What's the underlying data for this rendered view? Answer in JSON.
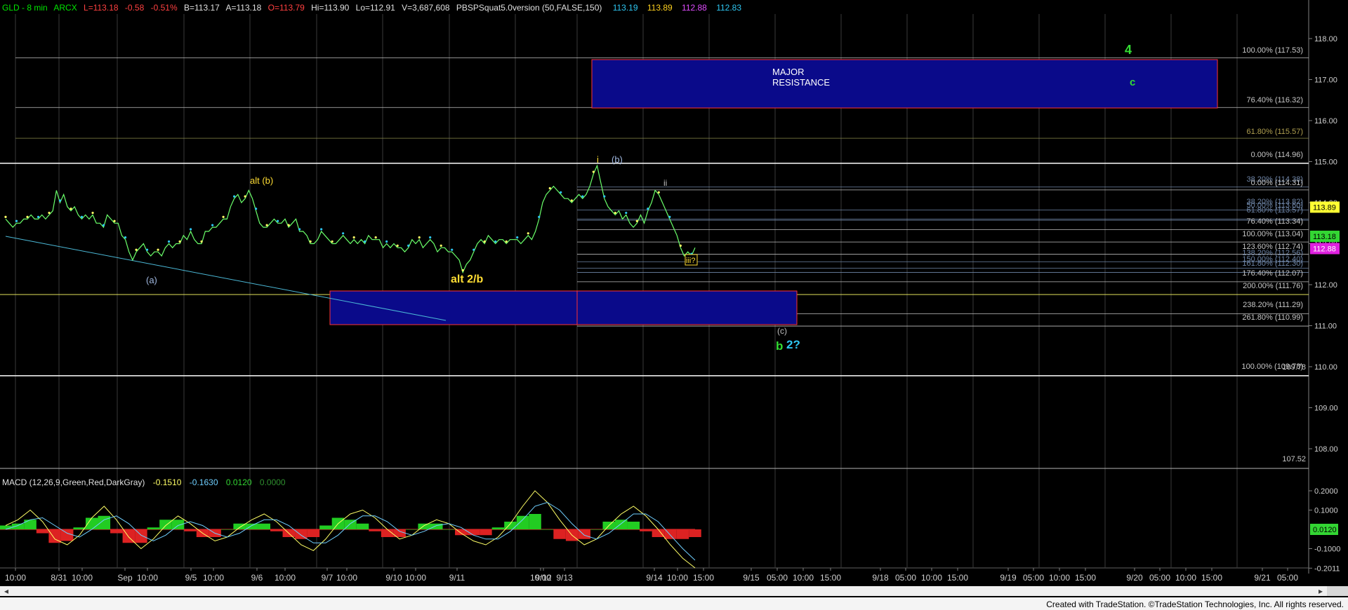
{
  "header": {
    "symbol": "GLD - 8 min",
    "exchange": "ARCX",
    "last": "L=113.18",
    "change": "-0.58",
    "change_pct": "-0.51%",
    "bid": "B=113.17",
    "ask": "A=113.18",
    "open": "O=113.79",
    "high": "Hi=113.90",
    "low": "Lo=112.91",
    "volume": "V=3,687,608",
    "study": "PBSPSquat5.0version (50,FALSE,150)",
    "study_values": [
      {
        "text": "113.19",
        "color": "#2ec7f2"
      },
      {
        "text": "113.89",
        "color": "#ffd21f"
      },
      {
        "text": "112.88",
        "color": "#e04cff"
      },
      {
        "text": "112.83",
        "color": "#2ec7f2"
      }
    ]
  },
  "price_axis": {
    "ticks": [
      "118.00",
      "117.00",
      "116.00",
      "115.00",
      "114.00",
      "113.00",
      "112.00",
      "111.00",
      "110.00",
      "109.00",
      "108.00"
    ],
    "badges": [
      {
        "text": "113.89",
        "color": "#ffff33",
        "text_color": "#000000"
      },
      {
        "text": "113.18",
        "color": "#33d633",
        "text_color": "#000000"
      },
      {
        "text": "112.88",
        "color": "#e020e0",
        "text_color": "#ffffff"
      }
    ]
  },
  "fib_labels": [
    {
      "text": "100.00% (117.53)",
      "color": "#c8c8c8"
    },
    {
      "text": "76.40% (116.32)",
      "color": "#c8c8c8"
    },
    {
      "text": "61.80% (115.57)",
      "color": "#b0a050"
    },
    {
      "text": "0.00% (114.96)",
      "color": "#c8c8c8"
    },
    {
      "text": "38.20% (114.38)",
      "color": "#6f86a8"
    },
    {
      "text": "0.00% (114.31)",
      "color": "#c8c8c8"
    },
    {
      "text": "38.20% (113.82)",
      "color": "#6f86a8"
    },
    {
      "text": "50.00% (113.60)",
      "color": "#6f86a8"
    },
    {
      "text": "61.80% (113.57)",
      "color": "#6f86a8"
    },
    {
      "text": "76.40% (113.34)",
      "color": "#c8c8c8"
    },
    {
      "text": "100.00% (113.04)",
      "color": "#c8c8c8"
    },
    {
      "text": "123.60% (112.74)",
      "color": "#c8c8c8"
    },
    {
      "text": "138.20% (112.56)",
      "color": "#6f86a8"
    },
    {
      "text": "150.00% (112.40)",
      "color": "#6f86a8"
    },
    {
      "text": "161.80% (112.30)",
      "color": "#6f86a8"
    },
    {
      "text": "176.40% (112.07)",
      "color": "#c8c8c8"
    },
    {
      "text": "200.00% (111.76)",
      "color": "#c8c8c8"
    },
    {
      "text": "238.20% (111.29)",
      "color": "#c8c8c8"
    },
    {
      "text": "261.80% (110.99)",
      "color": "#c8c8c8"
    },
    {
      "text": "100.00% (109.78)",
      "color": "#c8c8c8"
    },
    {
      "text": "109.78",
      "color": "#c8c8c8"
    },
    {
      "text": "107.52",
      "color": "#c8c8c8"
    }
  ],
  "annotations": {
    "wave_4": "4",
    "wave_c": "c",
    "major_resistance_1": "MAJOR",
    "major_resistance_2": "RESISTANCE",
    "wave_i": "i",
    "wave_b_paren": "(b)",
    "wave_ii": "ii",
    "wave_alt_b": "alt (b)",
    "wave_a_paren": "(a)",
    "wave_alt_2b": "alt 2/b",
    "wave_iii_q": "iii?",
    "wave_c_paren": "(c)",
    "wave_b": "b",
    "wave_2q": "2?"
  },
  "macd": {
    "title": "MACD (12,26,9,Green,Red,DarkGray)",
    "values": [
      {
        "text": "-0.1510",
        "color": "#ffff66"
      },
      {
        "text": "-0.1630",
        "color": "#6fcfff"
      },
      {
        "text": "0.0120",
        "color": "#33d633"
      },
      {
        "text": "0.0000",
        "color": "#2f8f2f"
      }
    ],
    "ticks": [
      "0.2000",
      "0.1000",
      "-0.1000",
      "-0.2011"
    ],
    "badge": "0.0120"
  },
  "time_axis": {
    "labels": [
      "10:00",
      "8/31",
      "10:00",
      "Sep",
      "10:00",
      "9/5",
      "10:00",
      "9/6",
      "10:00",
      "9/7",
      "10:00",
      "9/10",
      "10:00",
      "9/11",
      "9/12",
      "10:00",
      "9/13",
      "9/14",
      "10:00",
      "15:00",
      "9/15",
      "05:00",
      "10:00",
      "15:00",
      "9/18",
      "05:00",
      "10:00",
      "15:00",
      "9/19",
      "05:00",
      "10:00",
      "15:00",
      "9/20",
      "05:00",
      "10:00",
      "15:00",
      "9/21",
      "05:00"
    ]
  },
  "footer": {
    "credit": "Created with TradeStation. ©TradeStation Technologies, Inc. All rights reserved."
  },
  "chart_data": {
    "type": "line",
    "price_range": [
      107.52,
      118.4
    ],
    "close_series": [
      113.6,
      113.5,
      113.4,
      113.5,
      113.5,
      113.6,
      113.6,
      113.7,
      113.6,
      113.6,
      113.7,
      113.6,
      113.7,
      113.8,
      114.3,
      114.0,
      114.2,
      113.9,
      113.8,
      113.9,
      113.7,
      113.6,
      113.7,
      113.6,
      113.7,
      113.5,
      113.5,
      113.4,
      113.7,
      113.6,
      113.5,
      113.5,
      113.2,
      113.1,
      112.8,
      112.6,
      112.8,
      112.9,
      113.0,
      112.8,
      112.7,
      112.8,
      112.8,
      112.7,
      112.9,
      113.0,
      112.9,
      113.0,
      113.0,
      113.2,
      113.1,
      113.3,
      113.1,
      113.0,
      113.0,
      113.3,
      113.3,
      113.4,
      113.4,
      113.5,
      113.6,
      113.6,
      113.9,
      114.1,
      114.2,
      114.0,
      114.1,
      114.3,
      114.1,
      113.8,
      113.5,
      113.4,
      113.4,
      113.5,
      113.6,
      113.5,
      113.5,
      113.6,
      113.4,
      113.5,
      113.6,
      113.3,
      113.3,
      113.2,
      113.0,
      113.0,
      113.1,
      113.3,
      113.2,
      113.1,
      113.0,
      113.0,
      113.1,
      113.2,
      113.1,
      113.0,
      113.1,
      113.0,
      113.1,
      113.0,
      113.2,
      113.1,
      113.1,
      113.1,
      112.9,
      113.0,
      112.9,
      113.0,
      112.9,
      112.9,
      112.8,
      112.9,
      113.1,
      113.0,
      113.1,
      112.9,
      113.0,
      113.1,
      113.0,
      112.8,
      112.9,
      112.9,
      112.8,
      112.8,
      112.7,
      112.6,
      112.3,
      112.5,
      112.6,
      112.8,
      113.0,
      113.1,
      113.0,
      113.2,
      113.1,
      113.0,
      113.1,
      113.1,
      113.0,
      113.1,
      113.1,
      113.1,
      113.0,
      113.1,
      113.2,
      113.1,
      113.3,
      113.6,
      114.0,
      114.2,
      114.3,
      114.4,
      114.3,
      114.2,
      114.1,
      114.1,
      114.0,
      114.1,
      114.2,
      114.1,
      114.2,
      114.4,
      114.7,
      114.9,
      114.5,
      114.1,
      113.9,
      113.8,
      113.7,
      113.8,
      113.6,
      113.7,
      113.5,
      113.4,
      113.5,
      113.7,
      113.5,
      113.8,
      114.0,
      114.3,
      114.2,
      114.0,
      113.8,
      113.6,
      113.4,
      113.2,
      112.9,
      112.7,
      112.8,
      112.7,
      112.9
    ],
    "fib_levels": [
      117.53,
      116.32,
      115.57,
      114.96,
      114.38,
      114.31,
      113.82,
      113.6,
      113.57,
      113.34,
      113.04,
      112.74,
      112.56,
      112.4,
      112.3,
      112.07,
      111.76,
      111.29,
      110.99,
      109.78,
      107.52
    ],
    "macd_line": [
      0.02,
      0.05,
      0.1,
      0.04,
      -0.05,
      -0.08,
      -0.03,
      0.06,
      0.12,
      0.05,
      -0.04,
      -0.1,
      -0.05,
      0.02,
      0.07,
      0.03,
      -0.02,
      -0.06,
      -0.04,
      0.01,
      0.05,
      0.08,
      0.04,
      -0.02,
      -0.08,
      -0.11,
      -0.05,
      0.03,
      0.08,
      0.1,
      0.06,
      0.0,
      -0.05,
      -0.03,
      0.02,
      0.05,
      0.03,
      -0.02,
      -0.06,
      -0.08,
      -0.04,
      0.03,
      0.12,
      0.2,
      0.14,
      0.05,
      -0.03,
      -0.08,
      -0.05,
      0.02,
      0.08,
      0.12,
      0.07,
      0.0,
      -0.08,
      -0.15,
      -0.2
    ],
    "signal_line": [
      0.0,
      0.02,
      0.05,
      0.06,
      0.02,
      -0.02,
      -0.04,
      0.0,
      0.05,
      0.07,
      0.03,
      -0.03,
      -0.06,
      -0.03,
      0.02,
      0.04,
      0.02,
      -0.02,
      -0.04,
      -0.02,
      0.02,
      0.05,
      0.05,
      0.02,
      -0.03,
      -0.07,
      -0.07,
      -0.03,
      0.03,
      0.07,
      0.07,
      0.04,
      -0.01,
      -0.03,
      -0.01,
      0.02,
      0.03,
      0.01,
      -0.03,
      -0.05,
      -0.05,
      -0.01,
      0.05,
      0.12,
      0.14,
      0.1,
      0.03,
      -0.03,
      -0.05,
      -0.02,
      0.03,
      0.08,
      0.08,
      0.04,
      -0.03,
      -0.1,
      -0.16
    ],
    "macd_range": [
      -0.2011,
      0.22
    ],
    "last_macd": -0.151,
    "last_signal": -0.163,
    "last_diff": 0.012
  }
}
